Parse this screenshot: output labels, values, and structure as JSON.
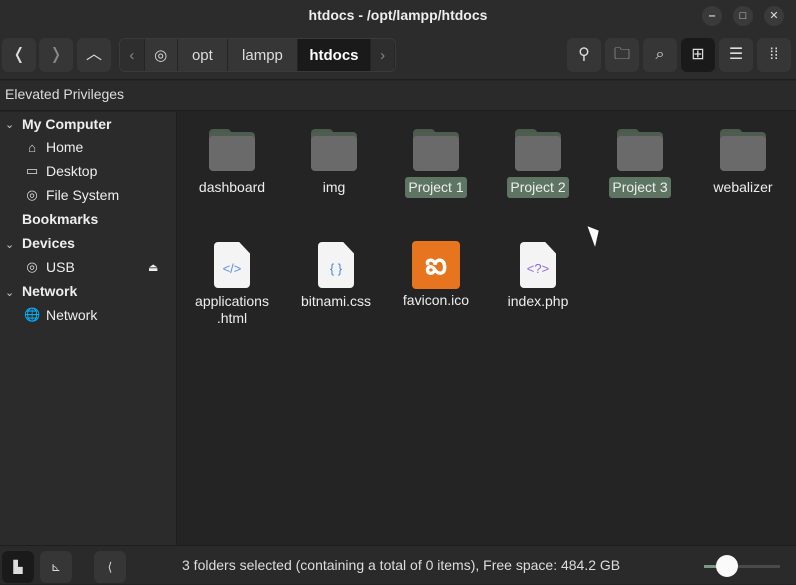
{
  "window": {
    "title": "htdocs - /opt/lampp/htdocs",
    "minimize": "‒",
    "maximize": "□",
    "close": "✕"
  },
  "toolbar": {
    "back": "❬",
    "forward": "❭",
    "up": "︿",
    "crumb_left": "‹",
    "crumb_right": "›",
    "breadcrumbs": [
      "opt",
      "lampp",
      "htdocs"
    ]
  },
  "banner": "Elevated Privileges",
  "sidebar": {
    "my_computer": "My Computer",
    "home": "Home",
    "desktop": "Desktop",
    "file_system": "File System",
    "bookmarks": "Bookmarks",
    "devices": "Devices",
    "usb": "USB",
    "network_header": "Network",
    "network": "Network"
  },
  "items": [
    {
      "name": "dashboard",
      "type": "folder",
      "selected": false
    },
    {
      "name": "img",
      "type": "folder",
      "selected": false
    },
    {
      "name": "Project 1",
      "type": "folder",
      "selected": true
    },
    {
      "name": "Project 2",
      "type": "folder",
      "selected": true
    },
    {
      "name": "Project 3",
      "type": "folder",
      "selected": true
    },
    {
      "name": "webalizer",
      "type": "folder",
      "selected": false
    },
    {
      "name": "applications\n.html",
      "type": "html",
      "glyph": "</>"
    },
    {
      "name": "bitnami.css",
      "type": "css",
      "glyph": "{ }"
    },
    {
      "name": "favicon.ico",
      "type": "ico",
      "glyph": "ఐ"
    },
    {
      "name": "index.php",
      "type": "php",
      "glyph": "<?>"
    }
  ],
  "status": "3 folders selected (containing a total of 0 items), Free space: 484.2 GB",
  "zoom_level": 0.3,
  "colors": {
    "selection": "#5e7563",
    "accent": "#7a9a80"
  }
}
